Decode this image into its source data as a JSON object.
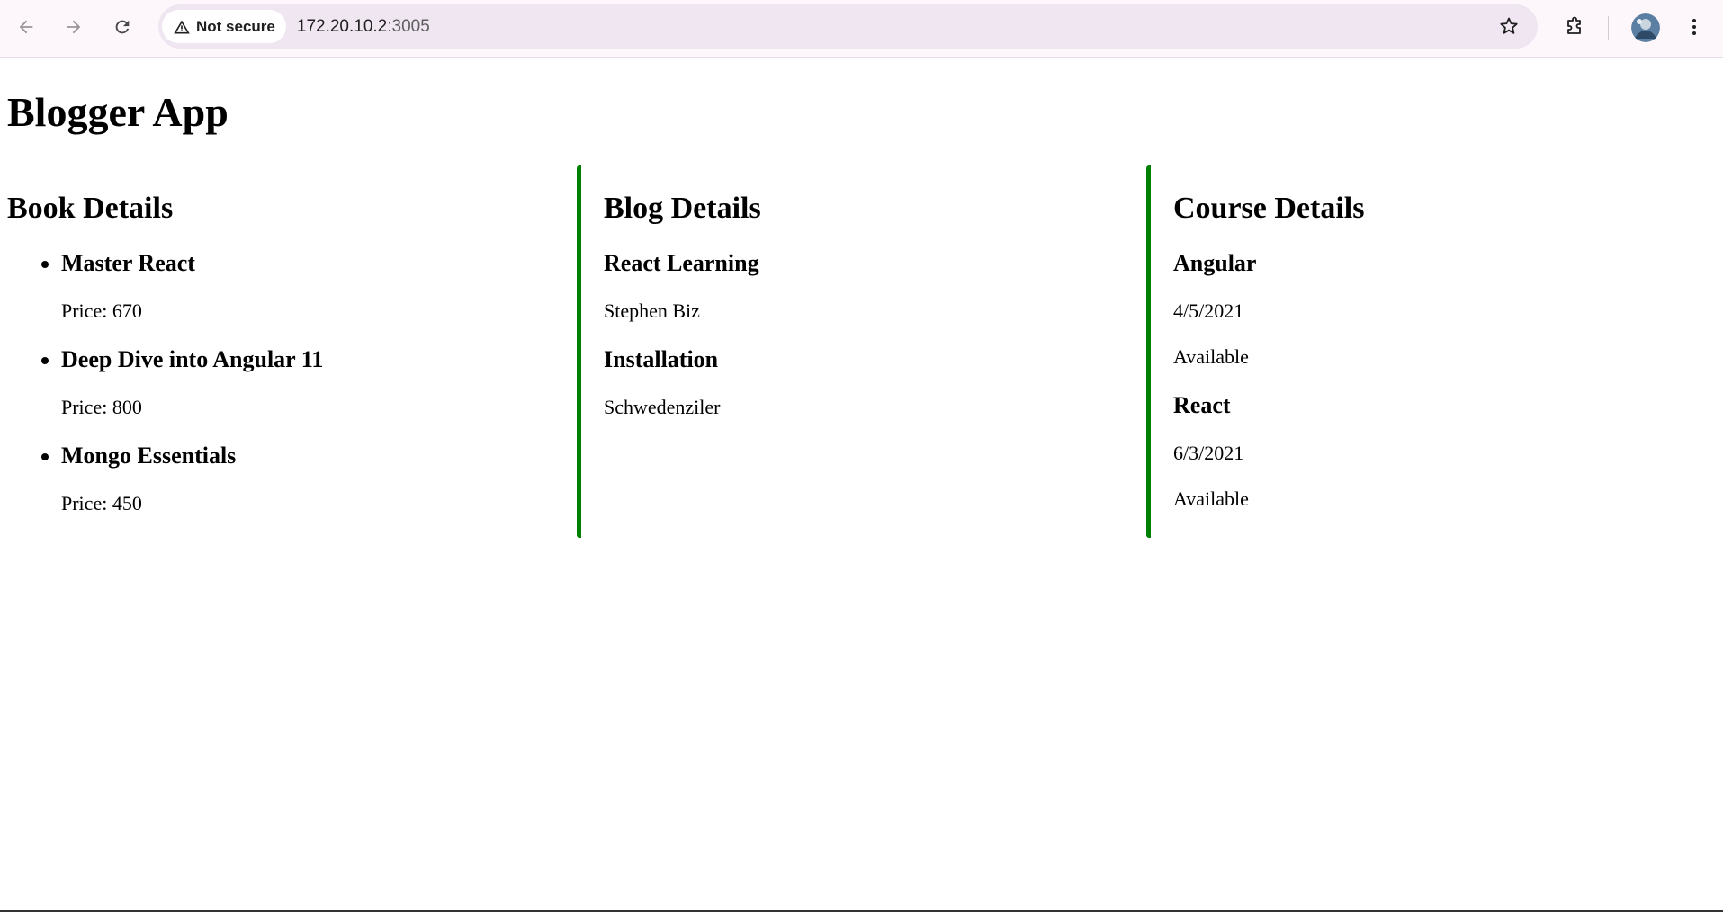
{
  "browser": {
    "security_label": "Not secure",
    "url_host": "172.20.10.2",
    "url_port": ":3005"
  },
  "colors": {
    "divider": "#008000",
    "toolbar_bg": "#fdf7fc",
    "omnibox_bg": "#efe6f1"
  },
  "icons": [
    "back-arrow-icon",
    "forward-arrow-icon",
    "reload-icon",
    "warning-triangle-icon",
    "star-icon",
    "extensions-icon",
    "avatar",
    "more-vert-icon"
  ],
  "page": {
    "title": "Blogger App"
  },
  "books": {
    "heading": "Book Details",
    "items": [
      {
        "name": "Master React",
        "price": "Price: 670"
      },
      {
        "name": "Deep Dive into Angular 11",
        "price": "Price: 800"
      },
      {
        "name": "Mongo Essentials",
        "price": "Price: 450"
      }
    ]
  },
  "blogs": {
    "heading": "Blog Details",
    "items": [
      {
        "title": "React Learning",
        "author": "Stephen Biz"
      },
      {
        "title": "Installation",
        "author": "Schwedenziler"
      }
    ]
  },
  "courses": {
    "heading": "Course Details",
    "items": [
      {
        "name": "Angular",
        "date": "4/5/2021",
        "status": "Available"
      },
      {
        "name": "React",
        "date": "6/3/2021",
        "status": "Available"
      }
    ]
  }
}
